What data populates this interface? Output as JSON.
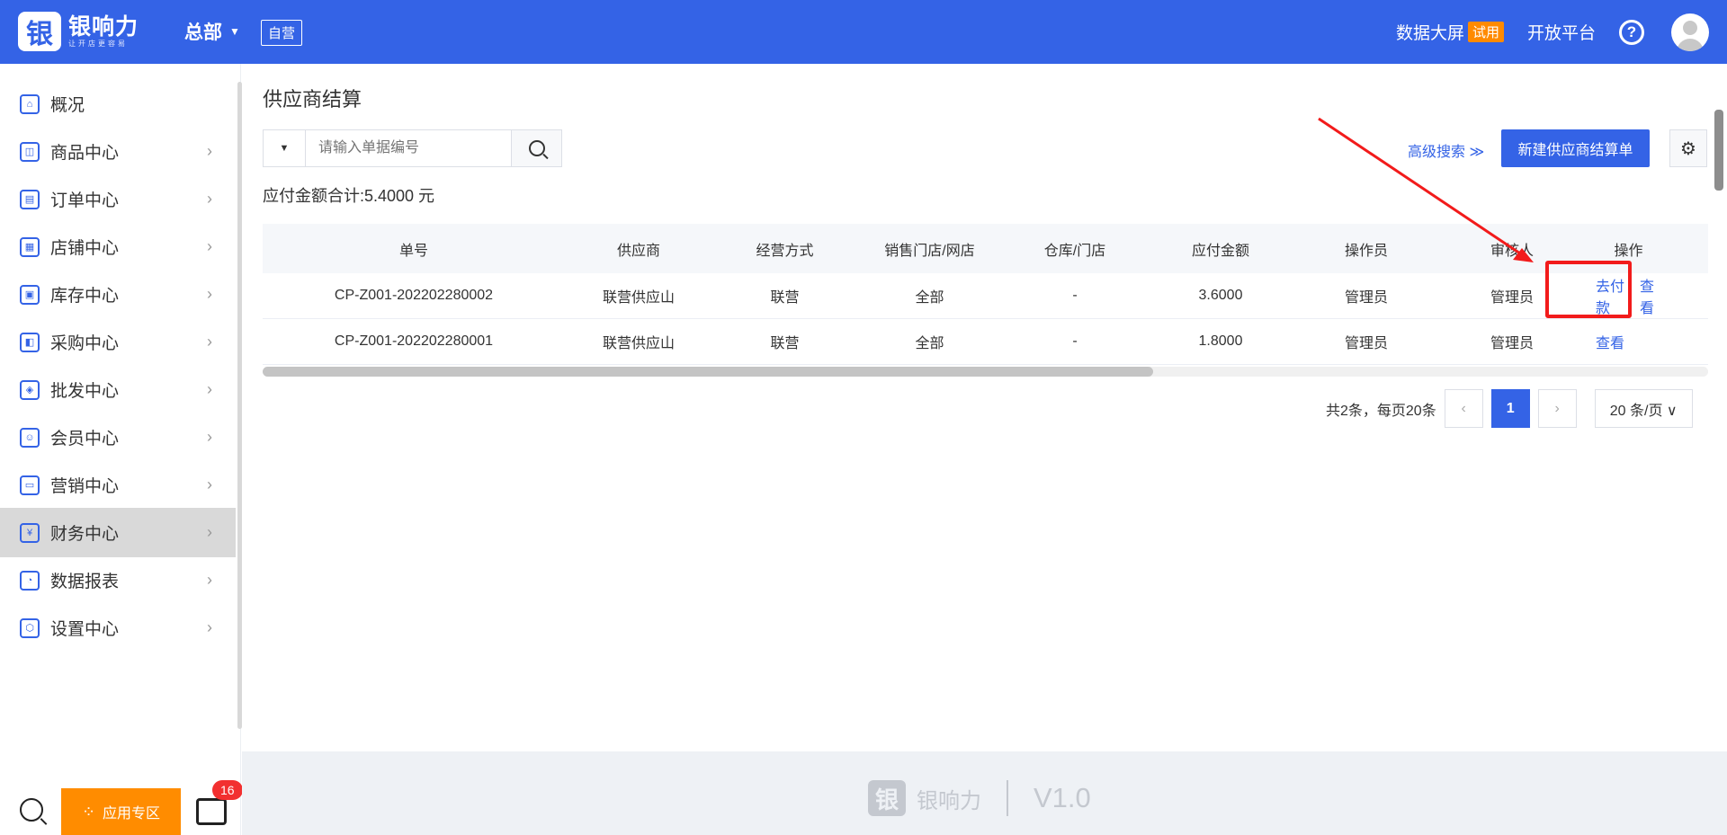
{
  "header": {
    "logo_glyph": "银",
    "logo_name": "银响力",
    "logo_sub": "让开店更容易",
    "store": "总部",
    "store_tag": "自营",
    "data_screen": "数据大屏",
    "trial": "试用",
    "open_platform": "开放平台",
    "help_glyph": "?"
  },
  "sidebar": {
    "items": [
      {
        "label": "概况",
        "icon": "home-icon"
      },
      {
        "label": "商品中心",
        "icon": "bag-icon"
      },
      {
        "label": "订单中心",
        "icon": "clipboard-icon"
      },
      {
        "label": "店铺中心",
        "icon": "store-icon"
      },
      {
        "label": "库存中心",
        "icon": "box-icon"
      },
      {
        "label": "采购中心",
        "icon": "cart-icon"
      },
      {
        "label": "批发中心",
        "icon": "map-icon"
      },
      {
        "label": "会员中心",
        "icon": "user-icon"
      },
      {
        "label": "营销中心",
        "icon": "ticket-icon"
      },
      {
        "label": "财务中心",
        "icon": "yen-icon"
      },
      {
        "label": "数据报表",
        "icon": "pie-chart-icon"
      },
      {
        "label": "设置中心",
        "icon": "settings-icon"
      }
    ],
    "active_index": 9,
    "apps_label": "应用专区",
    "msg_count": "16"
  },
  "main": {
    "title": "供应商结算",
    "search_type": "▼",
    "search_placeholder": "请输入单据编号",
    "advanced_search": "高级搜索 ≫",
    "new_button": "新建供应商结算单",
    "total": "应付金额合计:5.4000 元",
    "columns": [
      "单号",
      "供应商",
      "经营方式",
      "销售门店/网店",
      "仓库/门店",
      "应付金额",
      "操作员",
      "审核人",
      "操作"
    ],
    "rows": [
      {
        "no": "CP-Z001-202202280002",
        "supplier": "联营供应山",
        "mode": "联营",
        "store": "全部",
        "warehouse": "-",
        "amount": "3.6000",
        "operator": "管理员",
        "reviewer": "管理员",
        "pay": "去付款",
        "view": "查看"
      },
      {
        "no": "CP-Z001-202202280001",
        "supplier": "联营供应山",
        "mode": "联营",
        "store": "全部",
        "warehouse": "-",
        "amount": "1.8000",
        "operator": "管理员",
        "reviewer": "管理员",
        "pay": "",
        "view": "查看"
      }
    ],
    "pager": {
      "summary": "共2条，每页20条",
      "prev": "‹",
      "current": "1",
      "next": "›",
      "page_size": "20 条/页 ∨"
    }
  },
  "footer": {
    "logo_glyph": "银",
    "name": "银响力",
    "version": "V1.0"
  },
  "colors": {
    "primary": "#3463e6",
    "accent_orange": "#ff8c00",
    "annotation_red": "#f21b1b"
  }
}
